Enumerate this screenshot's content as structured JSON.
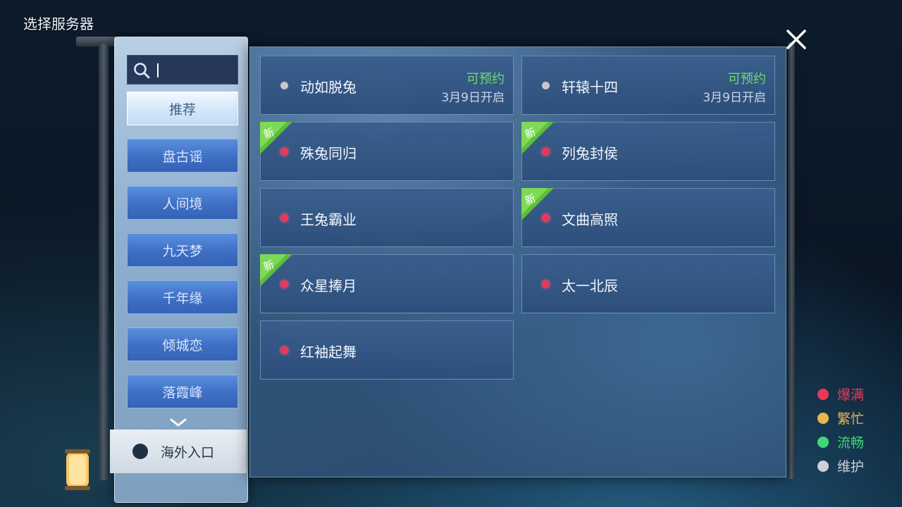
{
  "header": {
    "title": "选择服务器"
  },
  "search": {
    "value": ""
  },
  "sidebar": {
    "categories": [
      {
        "label": "推荐",
        "active": true
      },
      {
        "label": "盘古谣",
        "active": false
      },
      {
        "label": "人间境",
        "active": false
      },
      {
        "label": "九天梦",
        "active": false
      },
      {
        "label": "千年缘",
        "active": false
      },
      {
        "label": "倾城恋",
        "active": false
      },
      {
        "label": "落霞峰",
        "active": false
      }
    ],
    "overseas_label": "海外入口"
  },
  "servers": [
    {
      "name": "动如脱兔",
      "status": "maintenance",
      "is_new": false,
      "reserve_label": "可预约",
      "open_date": "3月9日开启"
    },
    {
      "name": "轩辕十四",
      "status": "maintenance",
      "is_new": false,
      "reserve_label": "可预约",
      "open_date": "3月9日开启"
    },
    {
      "name": "殊兔同归",
      "status": "full",
      "is_new": true
    },
    {
      "name": "列兔封侯",
      "status": "full",
      "is_new": true
    },
    {
      "name": "王兔霸业",
      "status": "full",
      "is_new": false
    },
    {
      "name": "文曲高照",
      "status": "full",
      "is_new": true
    },
    {
      "name": "众星捧月",
      "status": "full",
      "is_new": true
    },
    {
      "name": "太一北辰",
      "status": "full",
      "is_new": false
    },
    {
      "name": "红袖起舞",
      "status": "full",
      "is_new": false
    }
  ],
  "new_badge_label": "新",
  "legend": [
    {
      "label": "爆满",
      "color": "#e8385a"
    },
    {
      "label": "繁忙",
      "color": "#e8b84a"
    },
    {
      "label": "流畅",
      "color": "#3fd77a"
    },
    {
      "label": "维护",
      "color": "#d0d0d8"
    }
  ],
  "colors": {
    "reserve": "#6bdc6b",
    "active_category_bg": "#e6f0fb",
    "category_bg": "#4677c8"
  }
}
